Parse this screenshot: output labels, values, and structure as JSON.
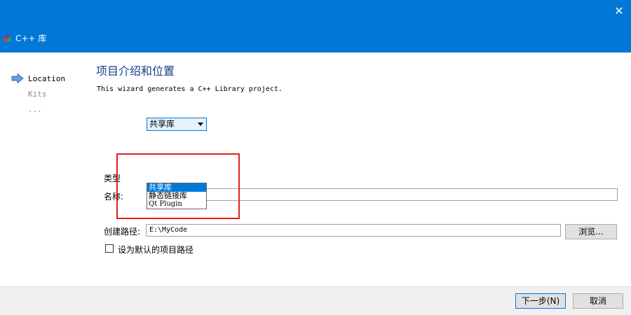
{
  "window": {
    "title": "C++ 库",
    "close_glyph": "✕"
  },
  "nav": {
    "items": [
      {
        "label": "Location",
        "active": true
      },
      {
        "label": "Kits",
        "active": false
      },
      {
        "label": "...",
        "active": false
      }
    ]
  },
  "main": {
    "title": "项目介绍和位置",
    "description": "This wizard generates a C++ Library project.",
    "type_label": "类型",
    "type_value": "共享库",
    "type_options": [
      "共享库",
      "静态链接库",
      "Qt Plugin"
    ],
    "name_label": "名称:",
    "name_value": "",
    "path_label": "创建路径:",
    "path_value": "E:\\MyCode",
    "browse_label": "浏览...",
    "default_path_label": "设为默认的项目路径",
    "default_path_checked": false
  },
  "footer": {
    "next_label": "下一步(N)",
    "cancel_label": "取消"
  },
  "colors": {
    "accent": "#0078d7",
    "highlight_box": "#e02020"
  }
}
